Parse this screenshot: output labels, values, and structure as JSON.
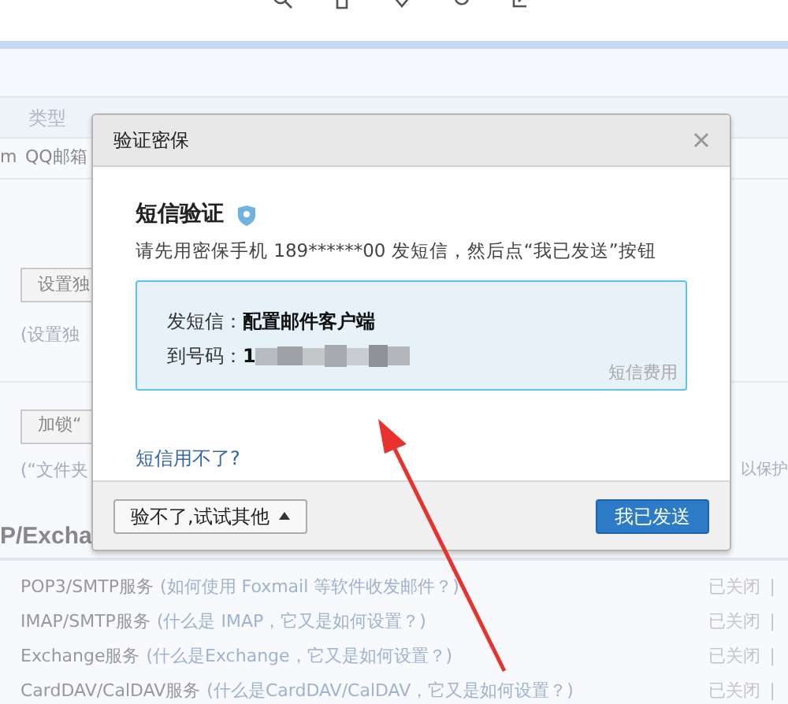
{
  "table": {
    "columns": [
      "类型"
    ],
    "rows": [
      {
        "column_1": "m",
        "column_2": "QQ邮箱"
      }
    ]
  },
  "sections": [
    {
      "button": "设置独",
      "note": "(设置独"
    },
    {
      "button": "加锁“",
      "note": "(“文件夹",
      "note_end": "以保护"
    }
  ],
  "heading": "P/Excha",
  "services": [
    {
      "name": "POP3/SMTP服务",
      "help": "(如何使用 Foxmail 等软件收发邮件？)",
      "status": "已关闭",
      "separator": "|"
    },
    {
      "name": "IMAP/SMTP服务",
      "help": "(什么是 IMAP，它又是如何设置？)",
      "status": "已关闭",
      "separator": "|"
    },
    {
      "name": "Exchange服务",
      "help": "(什么是Exchange，它又是如何设置？)",
      "status": "已关闭",
      "separator": "|"
    },
    {
      "name": "CardDAV/CalDAV服务",
      "help": "(什么是CardDAV/CalDAV，它又是如何设置？)",
      "status": "已关闭",
      "separator": "|"
    }
  ],
  "dialog": {
    "title": "验证密保",
    "section_title": "短信验证",
    "instruction": "请先用密保手机 189******00 发短信，然后点“我已发送”按钮",
    "sms_box": {
      "lines": [
        {
          "kind": "plain",
          "label": "发短信：",
          "value": "配置邮件客户端"
        },
        {
          "kind": "redacted",
          "label": "到号码：",
          "value": "1"
        }
      ],
      "fee_link": "短信费用"
    },
    "help_link": "短信用不了?",
    "other_button": "验不了,试试其他",
    "confirm_button": "我已发送"
  }
}
